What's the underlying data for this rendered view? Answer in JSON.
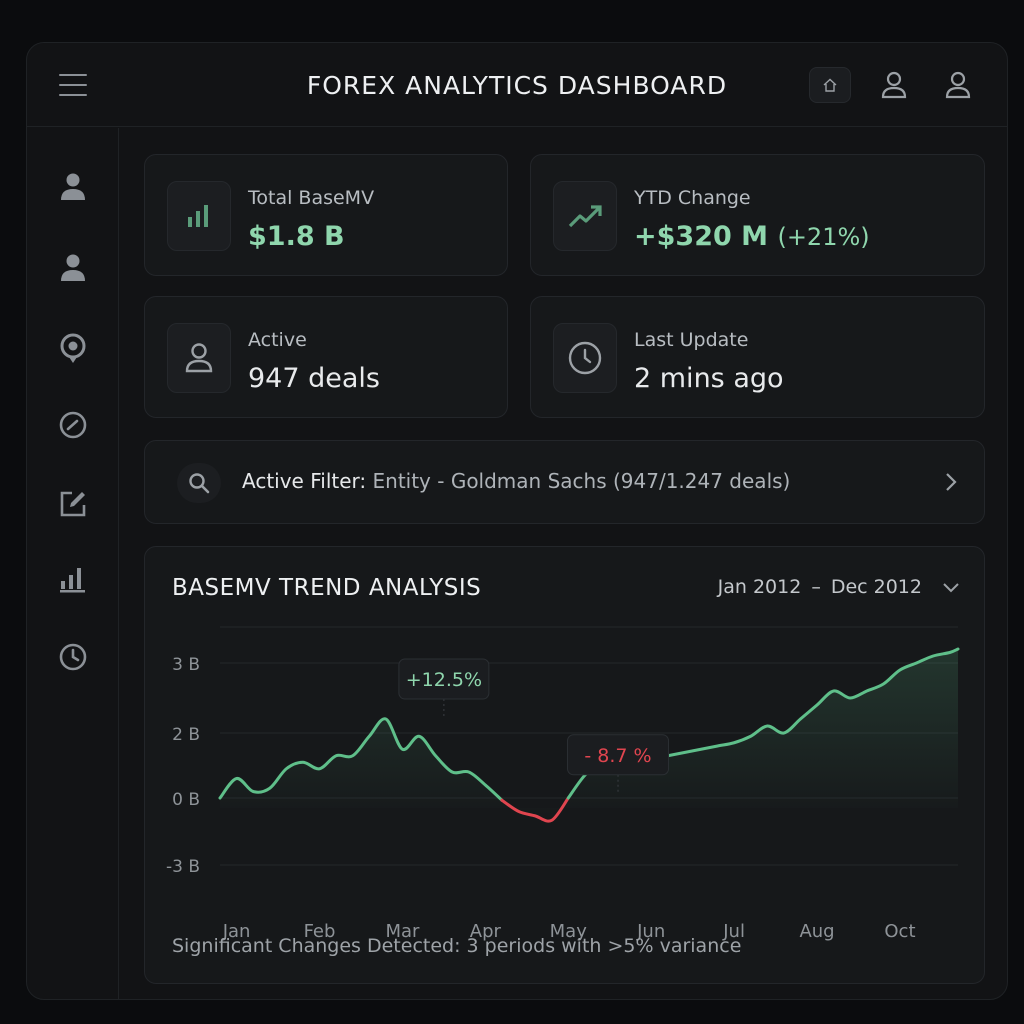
{
  "header": {
    "title": "FOREX ANALYTICS DASHBOARD"
  },
  "stats": {
    "total_basemv": {
      "label": "Total BaseMV",
      "value": "$1.8 B"
    },
    "ytd_change": {
      "label": "YTD Change",
      "value": "+$320 M",
      "percent": "(+21%)"
    },
    "active": {
      "label": "Active",
      "value": "947 deals"
    },
    "last_update": {
      "label": "Last Update",
      "value": "2 mins ago"
    }
  },
  "filter": {
    "label": "Active Filter:",
    "value": "Entity - Goldman Sachs (947/1.247 deals)"
  },
  "chart": {
    "title": "BASEMV TREND ANALYSIS",
    "range_start": "Jan 2012",
    "range_sep": "–",
    "range_end": "Dec 2012",
    "footnote": "Significant Changes Detected: 3 periods with >5% variance"
  },
  "colors": {
    "accent_green": "#5fbf8a",
    "accent_red": "#e0454f",
    "background": "#0b0c0e"
  },
  "chart_data": {
    "type": "line",
    "title": "BASEMV TREND ANALYSIS",
    "y_tick_labels": [
      "3 B",
      "2 B",
      "0 B",
      "-3 B"
    ],
    "y_tick_values": [
      3,
      2,
      0,
      -3
    ],
    "x_tick_labels": [
      "Jan",
      "Feb",
      "Mar",
      "Apr",
      "May",
      "Jun",
      "Jul",
      "Aug",
      "Oct"
    ],
    "x_tick_values": [
      0.2,
      1.2,
      2.2,
      3.2,
      4.2,
      5.2,
      6.2,
      7.2,
      8.2
    ],
    "grid": true,
    "series": [
      {
        "color_up": "#5fbf8a",
        "color_down": "#e0454f",
        "x": [
          0,
          0.2,
          0.4,
          0.6,
          0.8,
          1.0,
          1.2,
          1.4,
          1.6,
          1.8,
          2.0,
          2.2,
          2.4,
          2.6,
          2.8,
          3.0,
          3.2,
          3.4,
          3.6,
          3.8,
          4.0,
          4.2,
          4.4,
          4.6,
          4.8,
          5.0,
          5.2,
          5.4,
          5.6,
          5.8,
          6.0,
          6.2,
          6.4,
          6.6,
          6.8,
          7.0,
          7.2,
          7.4,
          7.6,
          7.8,
          8.0,
          8.2,
          8.4,
          8.6,
          8.8,
          8.9
        ],
        "y": [
          0.0,
          0.6,
          0.2,
          0.3,
          0.9,
          1.1,
          0.9,
          1.3,
          1.3,
          1.9,
          2.2,
          1.5,
          1.9,
          1.3,
          0.8,
          0.8,
          0.4,
          -0.1,
          -0.6,
          -0.8,
          -1.0,
          0.0,
          0.7,
          1.1,
          1.0,
          1.1,
          1.2,
          1.3,
          1.4,
          1.5,
          1.6,
          1.7,
          1.9,
          2.1,
          2.0,
          2.2,
          2.4,
          2.6,
          2.5,
          2.6,
          2.7,
          2.9,
          3.0,
          3.1,
          3.15,
          3.2
        ]
      }
    ],
    "annotations": [
      {
        "text": "+12.5%",
        "x": 2.7,
        "y": 2.2,
        "color": "#8fd6ad"
      },
      {
        "text": "- 8.7 %",
        "x": 4.8,
        "y": 0.1,
        "color": "#e0454f"
      }
    ]
  }
}
